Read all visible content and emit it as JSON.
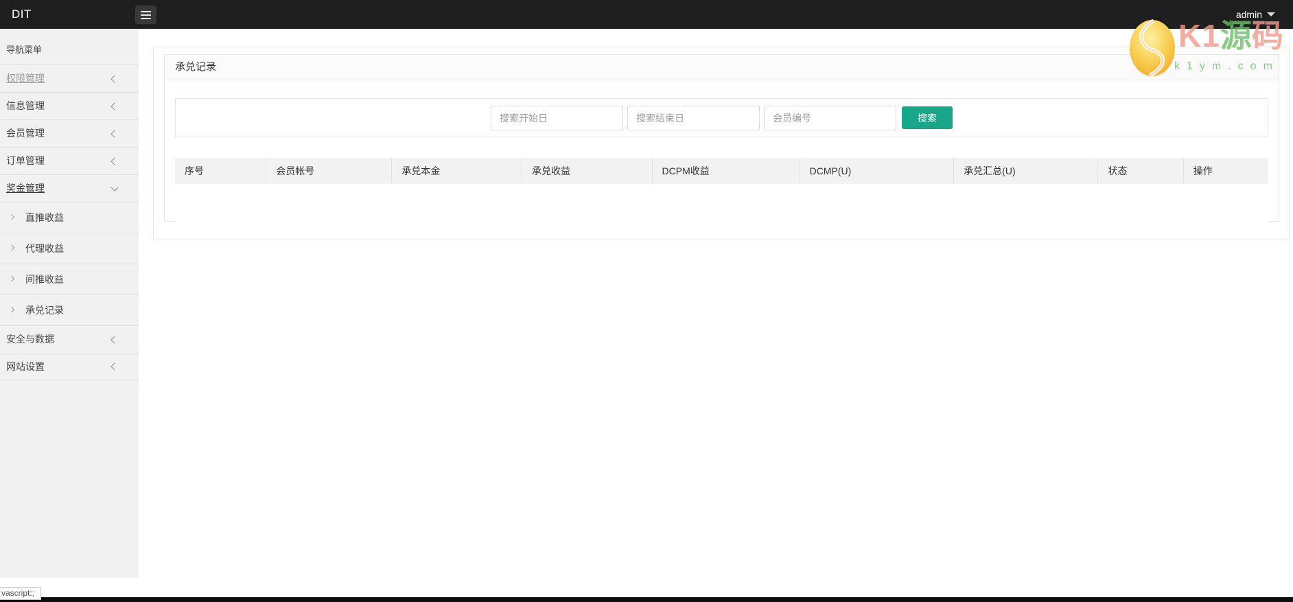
{
  "topbar": {
    "logo": "DIT",
    "user": "admin"
  },
  "sidebar": {
    "header": "导航菜单",
    "items": [
      {
        "label": "权限管理",
        "state": "collapsed"
      },
      {
        "label": "信息管理",
        "state": "collapsed"
      },
      {
        "label": "会员管理",
        "state": "collapsed"
      },
      {
        "label": "订单管理",
        "state": "collapsed"
      },
      {
        "label": "奖金管理",
        "state": "expanded"
      },
      {
        "label": "直推收益",
        "state": "sub"
      },
      {
        "label": "代理收益",
        "state": "sub"
      },
      {
        "label": "间推收益",
        "state": "sub"
      },
      {
        "label": "承兑记录",
        "state": "sub"
      },
      {
        "label": "安全与数据",
        "state": "collapsed"
      },
      {
        "label": "网站设置",
        "state": "collapsed"
      }
    ]
  },
  "panel": {
    "title": "承兑记录"
  },
  "search": {
    "inputs": [
      {
        "placeholder": "搜索开始日",
        "value": ""
      },
      {
        "placeholder": "搜索结束日",
        "value": ""
      },
      {
        "placeholder": "会员编号",
        "value": ""
      }
    ],
    "button": "搜索"
  },
  "table": {
    "headers": [
      "序号",
      "会员帐号",
      "承兑本金",
      "承兑收益",
      "DCPM收益",
      "DCMP(U)",
      "承兑汇总(U)",
      "状态",
      "操作"
    ],
    "rows": []
  },
  "watermark": {
    "text_k1": "K1",
    "text_yuan": "源",
    "text_ma": "码",
    "domain": "k1ym.com"
  },
  "statusbar": {
    "link_hint": "vascript:;"
  },
  "icons": {
    "menu_toggle": "hamburger",
    "collapsed_item": "chevron-left",
    "expanded_item": "chevron-down",
    "sub_item": "chevron-right",
    "user_menu": "caret-down"
  },
  "colors": {
    "accent": "#18a689",
    "topbar_bg": "#1e1e1e",
    "sidebar_bg": "#f1f1f1",
    "table_head_bg": "#f2f2f2",
    "watermark_salmon": "#f2998a",
    "watermark_green": "#6abf69"
  }
}
